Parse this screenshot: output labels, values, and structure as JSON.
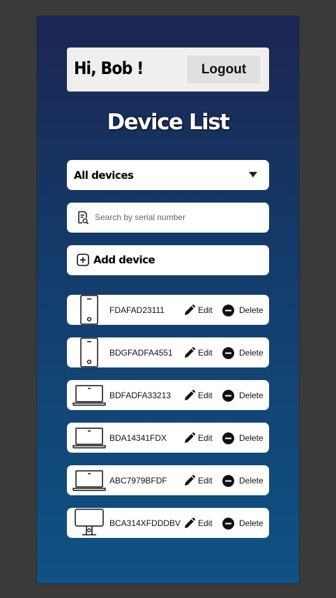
{
  "header": {
    "greeting": "Hi, Bob !",
    "logout_label": "Logout"
  },
  "page_title": "Device List",
  "filter": {
    "selected": "All devices"
  },
  "search": {
    "placeholder": "Search by serial number",
    "value": ""
  },
  "add_device_label": "Add device",
  "actions": {
    "edit_label": "Edit",
    "delete_label": "Delete"
  },
  "devices": [
    {
      "serial": "FDAFAD23111",
      "type": "phone-icon"
    },
    {
      "serial": "BDGFADFA4551",
      "type": "phone-icon"
    },
    {
      "serial": "BDFADFA33213",
      "type": "laptop-icon"
    },
    {
      "serial": "BDA14341FDX",
      "type": "laptop-icon"
    },
    {
      "serial": "ABC7979BFDF",
      "type": "laptop-icon"
    },
    {
      "serial": "BCA314XFDDDBV",
      "type": "monitor-icon"
    }
  ],
  "colors": {
    "background_top": "#1c2652",
    "background_bottom": "#0f5283",
    "card": "#ffffff",
    "header_card": "#efefef"
  }
}
